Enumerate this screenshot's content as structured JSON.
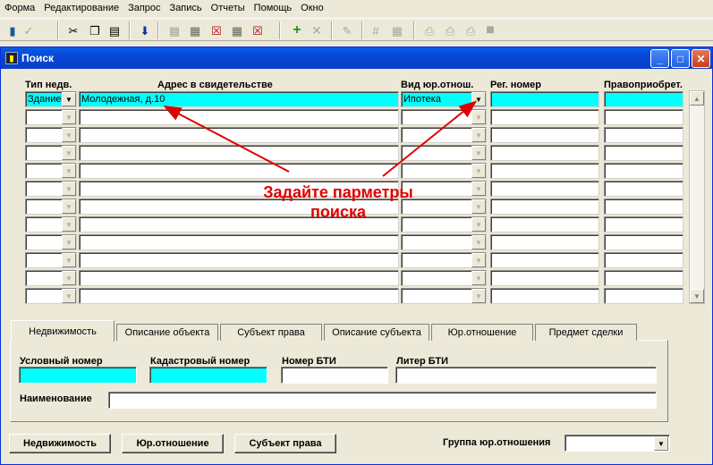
{
  "menu": [
    "Форма",
    "Редактирование",
    "Запрос",
    "Запись",
    "Отчеты",
    "Помощь",
    "Окно"
  ],
  "toolbar_icons": [
    "exit-icon",
    "check-icon",
    "cut-icon",
    "copy-icon",
    "paste-icon",
    "download-icon",
    "query-icon",
    "query-run-icon",
    "query-cancel-icon",
    "query-count-icon",
    "query-clear-icon",
    "add-record-icon",
    "delete-record-icon",
    "edit-icon",
    "grid-icon",
    "table-icon",
    "print-icon",
    "print-preview-icon",
    "print-setup-icon",
    "stop-icon"
  ],
  "window": {
    "title": "Поиск"
  },
  "grid": {
    "headers": {
      "type": "Тип недв.",
      "address": "Адрес в свидетельстве",
      "relation": "Вид юр.отнош.",
      "reg": "Рег. номер",
      "holder": "Правоприобрет."
    },
    "first_row": {
      "type": "Здание",
      "address": "Молодежная, д.10",
      "relation": "Ипотека",
      "reg": "",
      "holder": ""
    },
    "row_count": 12
  },
  "annotation": {
    "line1": "Задайте парметры",
    "line2": "поиска"
  },
  "tabs": [
    "Недвижимость",
    "Описание объекта",
    "Субъект права",
    "Описание субъекта",
    "Юр.отношение",
    "Предмет сделки"
  ],
  "panel": {
    "cond_number": "Условный номер",
    "cadastral": "Кадастровый номер",
    "bti_number": "Номер БТИ",
    "bti_letter": "Литер БТИ",
    "name": "Наименование"
  },
  "buttons": {
    "property": "Недвижимость",
    "relation": "Юр.отношение",
    "subject": "Субъект права"
  },
  "group_label": "Группа юр.отношения",
  "colors": {
    "active_cell": "#00ffff",
    "annotation": "#e00000",
    "title_bar": "#0548d6"
  }
}
